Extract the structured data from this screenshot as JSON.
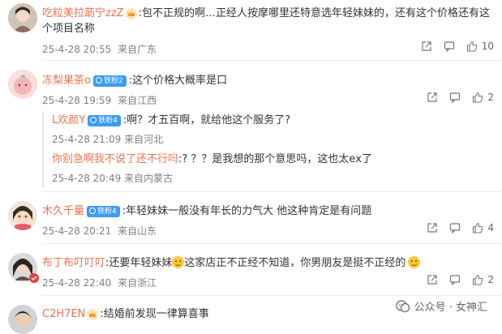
{
  "comments": [
    {
      "username": "吃粒美拉莇宁zzZ",
      "text_line1": ":包不正规的啊…正经人按摩哪里还特意选年轻妹妹的，还有这个价格还有这",
      "text_line2": "个项目名称",
      "date": "25-4-28 20:55",
      "location": "来自广东",
      "likes": "10",
      "share_icon": "share-icon",
      "reply_icon": "comment-icon",
      "like_icon": "thumbs-up-icon"
    },
    {
      "username": "冻梨果茶o",
      "badge": "铁粉2",
      "text": ":这个价格大概率是口",
      "date": "25-4-28 19:59",
      "location": "来自江西",
      "likes": "2",
      "replies": [
        {
          "username": "L欢颜Y",
          "badge": "铁粉4",
          "text": ":啊？才五百啊，就给他这个服务了?",
          "date": "25-4-28 21:09",
          "location": "来自河北"
        },
        {
          "username": "你别急啊我不说了还不行吗",
          "text": ":? ？？是我想的那个意思吗，这也太ex了",
          "date": "25-4-28 20:49",
          "location": "来自内蒙古"
        }
      ]
    },
    {
      "username": "木久千量",
      "badge": "铁粉4",
      "text": ":年轻妹妹一般没有年长的力气大 他这种肯定是有问题",
      "date": "25-4-28 20:21",
      "location": "来自山东",
      "likes": "4"
    },
    {
      "username": "布丁布叮叮叮",
      "text_a": ":还要年轻妹妹",
      "text_b": "这家店正不正经不知道，你男朋友是挺不正经的",
      "date": "25-4-28 22:40",
      "location": "来自浙江",
      "likes": "2"
    },
    {
      "username": "C2H7EN",
      "text": ":结婚前发现一律算喜事"
    }
  ],
  "watermark": "公众号 · 女神汇",
  "colors": {
    "username": "#eb7350",
    "badge": "#3b9cf5",
    "meta": "#808080"
  }
}
